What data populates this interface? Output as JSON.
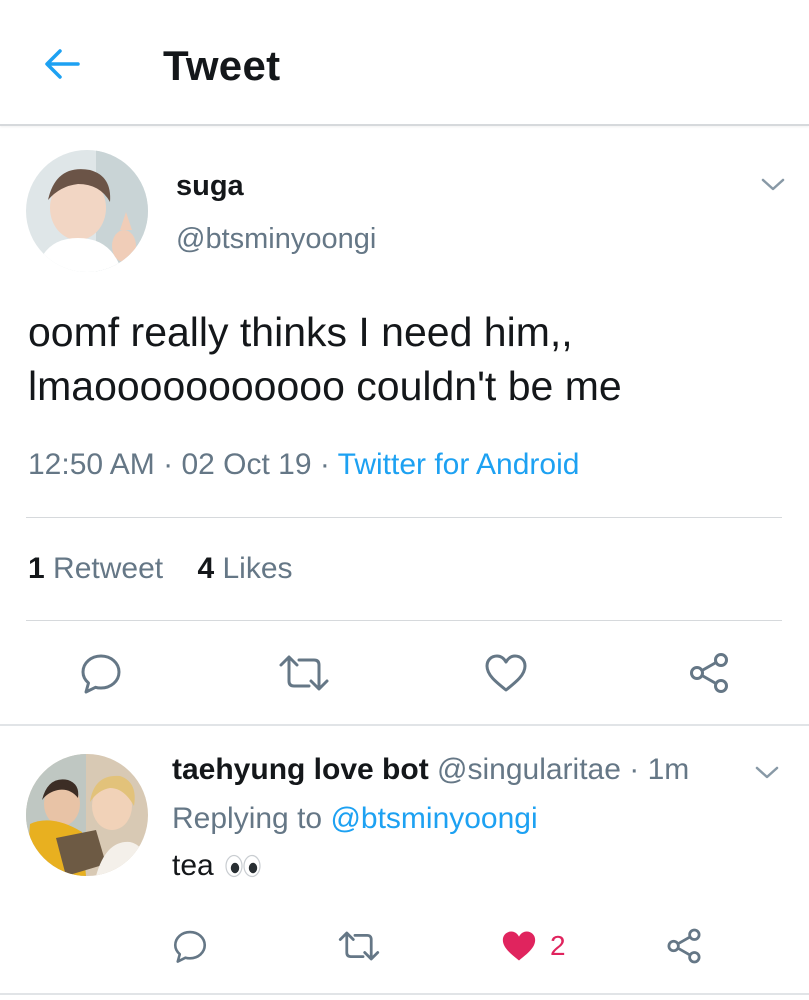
{
  "header": {
    "title": "Tweet"
  },
  "tweet": {
    "display_name": "suga",
    "handle": "@btsminyoongi",
    "text_lines": [
      "oomf really thinks I need him,,",
      "lmaooooooooooo couldn't be me"
    ],
    "time": "12:50 AM",
    "date": "02 Oct 19",
    "source": "Twitter for Android",
    "retweet_count": "1",
    "retweet_label": "Retweet",
    "like_count": "4",
    "like_label": "Likes"
  },
  "reply": {
    "display_name": "taehyung love bot",
    "handle": "@singularitae",
    "age": "1m",
    "replying_prefix": "Replying to",
    "replying_to": "@btsminyoongi",
    "text": "tea",
    "emoji_icon": "eyes-icon",
    "like_count": "2",
    "liked": true
  },
  "colors": {
    "accent": "#1da1f2",
    "text_primary": "#14171a",
    "text_secondary": "#657786",
    "like_active": "#e0245e",
    "divider": "#d6d9dc"
  }
}
